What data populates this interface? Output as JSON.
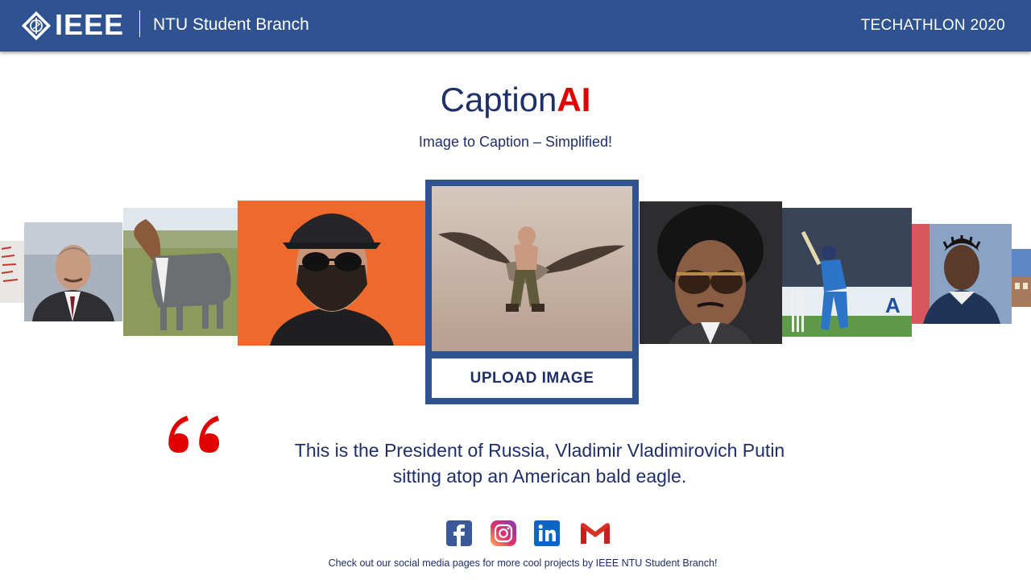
{
  "header": {
    "logo_text": "IEEE",
    "branch": "NTU Student Branch",
    "event": "TECHATHLON  2020"
  },
  "hero": {
    "title_part1": "Caption",
    "title_part2": "AI",
    "subtitle": "Image to Caption – Simplified!"
  },
  "upload": {
    "button_label": "UPLOAD IMAGE"
  },
  "caption": {
    "line1": "This is the President of Russia, Vladimir Vladimirovich Putin",
    "line2": "sitting atop an American bald eagle."
  },
  "social": [
    {
      "name": "facebook-icon",
      "color": "#3b5998"
    },
    {
      "name": "instagram-icon",
      "color": "#c13584"
    },
    {
      "name": "linkedin-icon",
      "color": "#0a66c2"
    },
    {
      "name": "gmail-icon",
      "color": "#d93025"
    }
  ],
  "footer": {
    "text": "Check out our social media pages for more cool projects by IEEE NTU Student Branch!"
  },
  "colors": {
    "brand_blue": "#2f5291",
    "text_navy": "#1f2f6b",
    "accent_red": "#e00000"
  }
}
